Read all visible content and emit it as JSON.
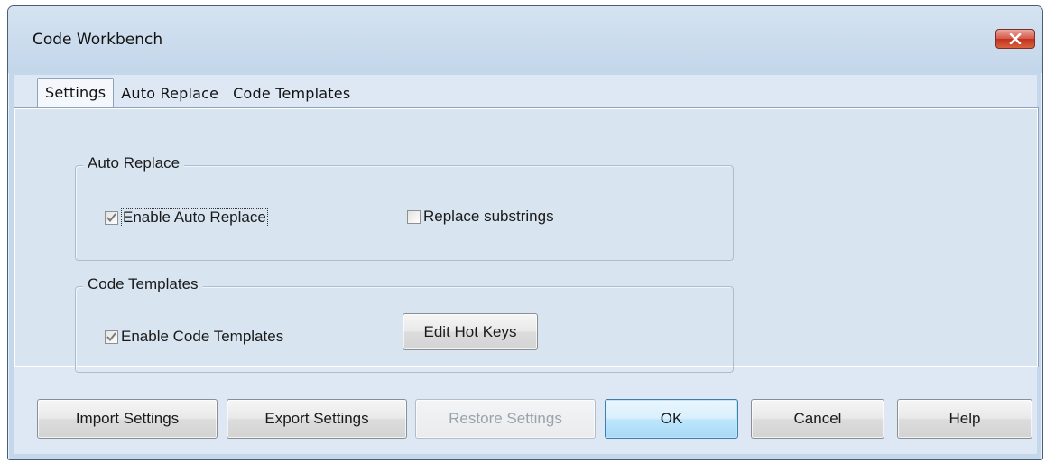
{
  "window": {
    "title": "Code Workbench"
  },
  "tabs": [
    {
      "label": "Settings",
      "active": true
    },
    {
      "label": "Auto Replace",
      "active": false
    },
    {
      "label": "Code Templates",
      "active": false
    }
  ],
  "groups": {
    "auto_replace": {
      "label": "Auto Replace",
      "enable_auto_replace": {
        "label": "Enable Auto Replace",
        "checked": true
      },
      "replace_substrings": {
        "label": "Replace substrings",
        "checked": false
      }
    },
    "code_templates": {
      "label": "Code Templates",
      "enable_code_templates": {
        "label": "Enable Code Templates",
        "checked": true
      },
      "edit_hot_keys_label": "Edit Hot Keys"
    }
  },
  "buttons": {
    "import_settings": "Import Settings",
    "export_settings": "Export Settings",
    "restore_settings": "Restore Settings",
    "ok": "OK",
    "cancel": "Cancel",
    "help": "Help"
  },
  "colors": {
    "frame": "#c5d7ea",
    "client": "#dde8f4",
    "close_button": "#c3301f",
    "default_button_border": "#3c7fb1"
  }
}
